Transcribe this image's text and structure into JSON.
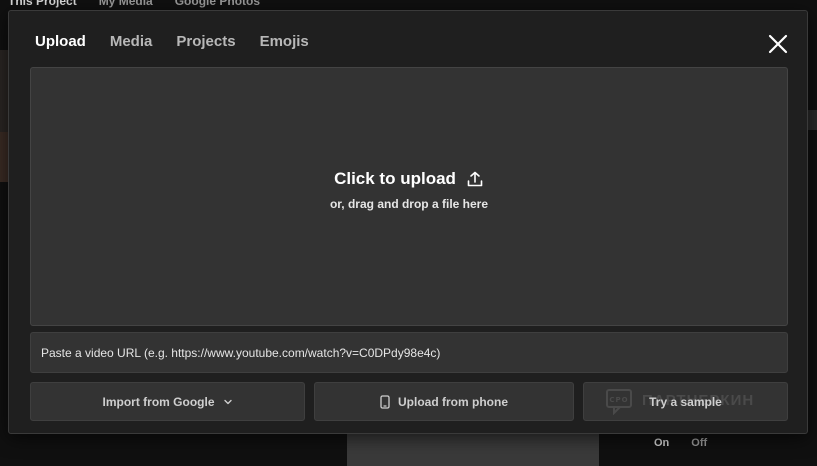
{
  "background": {
    "tabs": [
      "This Project",
      "My Media",
      "Google Photos"
    ],
    "toggle": {
      "on": "On",
      "off": "Off"
    }
  },
  "modal": {
    "tabs": [
      {
        "label": "Upload",
        "active": true
      },
      {
        "label": "Media",
        "active": false
      },
      {
        "label": "Projects",
        "active": false
      },
      {
        "label": "Emojis",
        "active": false
      }
    ],
    "close_icon": "close-icon",
    "dropzone": {
      "title": "Click to upload",
      "subtitle": "or, drag and drop a file here",
      "icon": "upload-icon"
    },
    "url_input": {
      "placeholder": "Paste a video URL (e.g. https://www.youtube.com/watch?v=C0DPdy98e4c)",
      "value": ""
    },
    "buttons": {
      "google": "Import from Google",
      "phone": "Upload from phone",
      "sample": "Try a sample"
    },
    "watermark_text": "ПАРТНЕРКИН"
  },
  "colors": {
    "modal_bg": "#1f1f1f",
    "panel_bg": "#333333",
    "text_primary": "#ffffff",
    "text_secondary": "#cfcfcf"
  }
}
